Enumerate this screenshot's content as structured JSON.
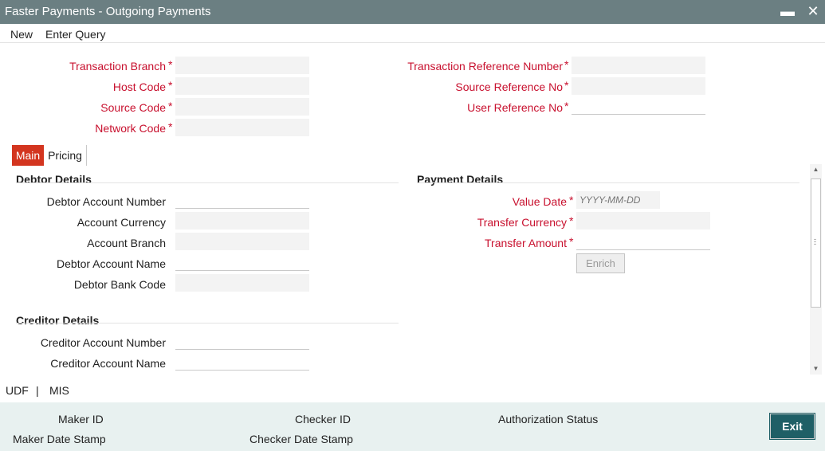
{
  "window": {
    "title": "Faster Payments - Outgoing Payments",
    "minimize_glyph": "▬",
    "close_glyph": "✕"
  },
  "menu": {
    "new_label": "New",
    "enter_query_label": "Enter Query"
  },
  "header_fields": {
    "transaction_branch": {
      "label": "Transaction Branch",
      "value": ""
    },
    "host_code": {
      "label": "Host Code",
      "value": ""
    },
    "source_code": {
      "label": "Source Code",
      "value": ""
    },
    "network_code": {
      "label": "Network Code",
      "value": ""
    },
    "transaction_reference_number": {
      "label": "Transaction Reference Number",
      "value": ""
    },
    "source_reference_no": {
      "label": "Source Reference No",
      "value": ""
    },
    "user_reference_no": {
      "label": "User Reference No",
      "value": ""
    }
  },
  "required_marker": "*",
  "tabs": [
    {
      "label": "Main",
      "active": true
    },
    {
      "label": "Pricing",
      "active": false
    }
  ],
  "debtor_details": {
    "heading": "Debtor Details",
    "debtor_account_number": {
      "label": "Debtor Account Number",
      "value": ""
    },
    "account_currency": {
      "label": "Account Currency",
      "value": ""
    },
    "account_branch": {
      "label": "Account Branch",
      "value": ""
    },
    "debtor_account_name": {
      "label": "Debtor Account Name",
      "value": ""
    },
    "debtor_bank_code": {
      "label": "Debtor Bank Code",
      "value": ""
    }
  },
  "creditor_details": {
    "heading": "Creditor Details",
    "creditor_account_number": {
      "label": "Creditor Account Number",
      "value": ""
    },
    "creditor_account_name": {
      "label": "Creditor Account Name",
      "value": ""
    }
  },
  "payment_details": {
    "heading": "Payment Details",
    "value_date": {
      "label": "Value Date",
      "value": "",
      "placeholder": "YYYY-MM-DD"
    },
    "transfer_currency": {
      "label": "Transfer Currency",
      "value": ""
    },
    "transfer_amount": {
      "label": "Transfer Amount",
      "value": ""
    },
    "enrich_label": "Enrich"
  },
  "footer_links": {
    "udf": "UDF",
    "separator": "|",
    "mis": "MIS"
  },
  "audit": {
    "maker_id": "Maker ID",
    "maker_date_stamp": "Maker Date Stamp",
    "checker_id": "Checker ID",
    "checker_date_stamp": "Checker Date Stamp",
    "authorization_status": "Authorization Status",
    "exit_label": "Exit"
  },
  "colors": {
    "title_bar": "#6b7f82",
    "required_label": "#c8102e",
    "active_tab": "#d3351f",
    "audit_panel": "#e8f1f0",
    "exit_button": "#1f5f66"
  }
}
